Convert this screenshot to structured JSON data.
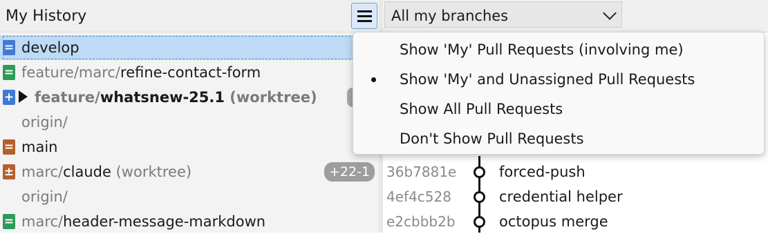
{
  "left": {
    "title": "My History",
    "menu_icon": "hamburger-menu-icon",
    "branches": [
      {
        "icon": "=",
        "icon_color": "#3f7ad6",
        "prefix": "",
        "name": "develop",
        "suffix": "",
        "bold": false,
        "selected": true,
        "expander": false,
        "count": ""
      },
      {
        "icon": "=",
        "icon_color": "#2e9a5a",
        "prefix": "feature/marc/",
        "name": "refine-contact-form",
        "suffix": "",
        "bold": false,
        "selected": false,
        "expander": false,
        "count": ""
      },
      {
        "icon": "+",
        "icon_color": "#3f7ad6",
        "prefix": "feature/",
        "name": "whatsnew-25.1",
        "suffix": " (worktree)",
        "bold": true,
        "selected": false,
        "expander": true,
        "count": ""
      },
      {
        "icon": "",
        "icon_color": "",
        "prefix": "origin/",
        "name": "",
        "suffix": "",
        "bold": false,
        "selected": false,
        "expander": false,
        "count": ""
      },
      {
        "icon": "=",
        "icon_color": "#b3602a",
        "prefix": "",
        "name": "main",
        "suffix": "",
        "bold": false,
        "selected": false,
        "expander": false,
        "count": ""
      },
      {
        "icon": "±",
        "icon_color": "#b3602a",
        "prefix": "marc/",
        "name": "claude",
        "suffix": " (worktree)",
        "bold": false,
        "selected": false,
        "expander": false,
        "count": "+22-1"
      },
      {
        "icon": "",
        "icon_color": "",
        "prefix": "origin/",
        "name": "",
        "suffix": "",
        "bold": false,
        "selected": false,
        "expander": false,
        "count": ""
      },
      {
        "icon": "=",
        "icon_color": "#2e9a5a",
        "prefix": "marc/",
        "name": "header-message-markdown",
        "suffix": "",
        "bold": false,
        "selected": false,
        "expander": false,
        "count": ""
      }
    ]
  },
  "right": {
    "branch_filter": "All my branches",
    "commits": [
      {
        "sha": "36b7881e",
        "message": "forced-push"
      },
      {
        "sha": "4ef4c528",
        "message": "credential helper"
      },
      {
        "sha": "e2cbbb2b",
        "message": "octopus merge"
      }
    ]
  },
  "popup": {
    "items": [
      {
        "label": "Show 'My' Pull Requests (involving me)",
        "checked": false
      },
      {
        "label": "Show 'My' and Unassigned Pull Requests",
        "checked": true
      },
      {
        "label": "Show All Pull Requests",
        "checked": false
      },
      {
        "label": "Don't Show Pull Requests",
        "checked": false
      }
    ]
  }
}
